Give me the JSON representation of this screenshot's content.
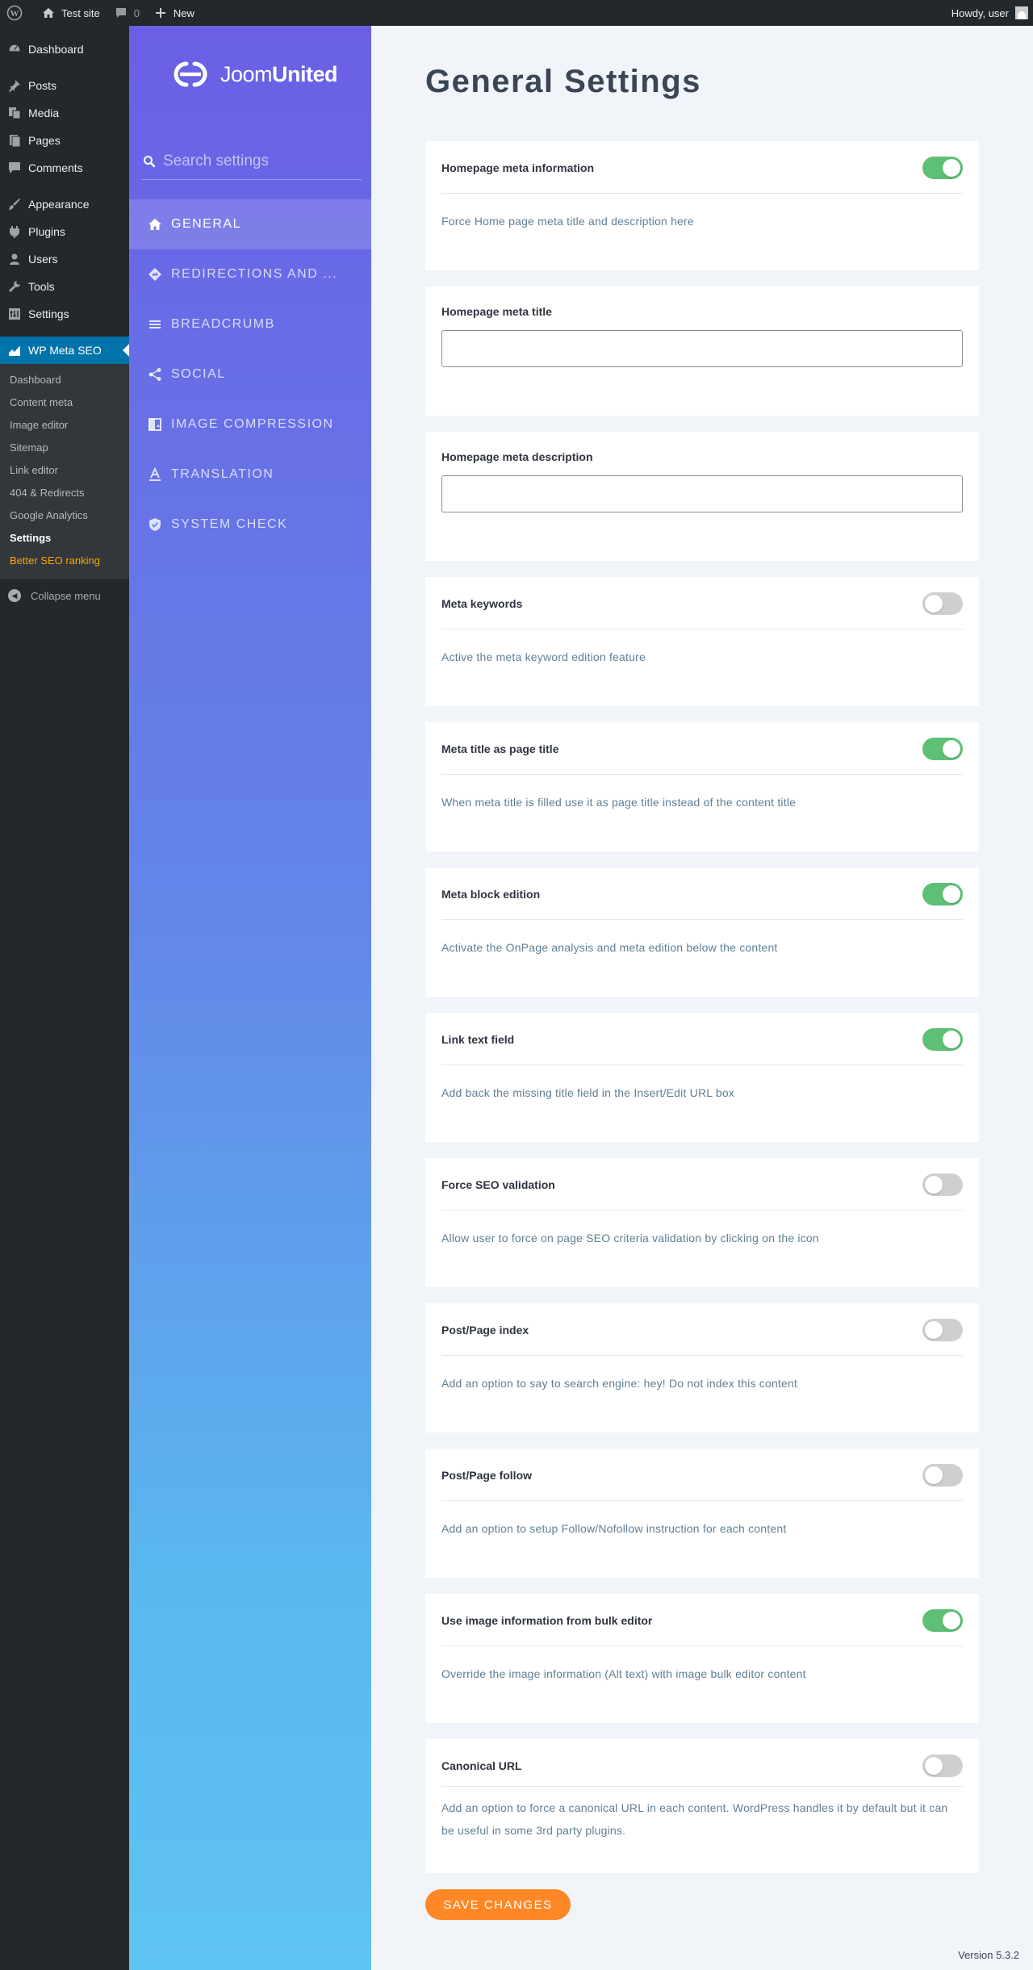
{
  "adminbar": {
    "site_name": "Test site",
    "comments_count": "0",
    "new_label": "New",
    "howdy": "Howdy, user"
  },
  "adminmenu": {
    "items": [
      {
        "label": "Dashboard",
        "icon": "dashboard-icon"
      },
      {
        "label": "Posts",
        "icon": "pin-icon"
      },
      {
        "label": "Media",
        "icon": "media-icon"
      },
      {
        "label": "Pages",
        "icon": "pages-icon"
      },
      {
        "label": "Comments",
        "icon": "comment-icon"
      },
      {
        "label": "Appearance",
        "icon": "brush-icon"
      },
      {
        "label": "Plugins",
        "icon": "plug-icon"
      },
      {
        "label": "Users",
        "icon": "user-icon"
      },
      {
        "label": "Tools",
        "icon": "wrench-icon"
      },
      {
        "label": "Settings",
        "icon": "settings-icon"
      },
      {
        "label": "WP Meta SEO",
        "icon": "chart-icon"
      }
    ],
    "submenu": [
      "Dashboard",
      "Content meta",
      "Image editor",
      "Sitemap",
      "Link editor",
      "404 & Redirects",
      "Google Analytics",
      "Settings",
      "Better SEO ranking"
    ],
    "collapse_label": "Collapse menu"
  },
  "plugin_sidebar": {
    "logo_text_light": "Joom",
    "logo_text_bold": "United",
    "search_placeholder": "Search settings",
    "nav": [
      {
        "label": "GENERAL",
        "icon": "home-icon"
      },
      {
        "label": "REDIRECTIONS AND ...",
        "icon": "directions-icon"
      },
      {
        "label": "BREADCRUMB",
        "icon": "breadcrumb-icon"
      },
      {
        "label": "SOCIAL",
        "icon": "share-icon"
      },
      {
        "label": "IMAGE COMPRESSION",
        "icon": "image-compression-icon"
      },
      {
        "label": "TRANSLATION",
        "icon": "translation-icon"
      },
      {
        "label": "SYSTEM CHECK",
        "icon": "shield-check-icon"
      }
    ]
  },
  "main": {
    "title": "General Settings",
    "settings": [
      {
        "label": "Homepage meta information",
        "type": "toggle",
        "on": true,
        "desc": "Force Home page meta title and description here"
      },
      {
        "label": "Homepage meta title",
        "type": "text",
        "value": ""
      },
      {
        "label": "Homepage meta description",
        "type": "text",
        "value": ""
      },
      {
        "label": "Meta keywords",
        "type": "toggle",
        "on": false,
        "desc": "Active the meta keyword edition feature"
      },
      {
        "label": "Meta title as page title",
        "type": "toggle",
        "on": true,
        "desc": "When meta title is filled use it as page title instead of the content title"
      },
      {
        "label": "Meta block edition",
        "type": "toggle",
        "on": true,
        "desc": "Activate the OnPage analysis and meta edition below the content"
      },
      {
        "label": "Link text field",
        "type": "toggle",
        "on": true,
        "desc": "Add back the missing title field in the Insert/Edit URL box"
      },
      {
        "label": "Force SEO validation",
        "type": "toggle",
        "on": false,
        "desc": "Allow user to force on page SEO criteria validation by clicking on the icon"
      },
      {
        "label": "Post/Page index",
        "type": "toggle",
        "on": false,
        "desc": "Add an option to say to search engine: hey! Do not index this content"
      },
      {
        "label": "Post/Page follow",
        "type": "toggle",
        "on": false,
        "desc": "Add an option to setup Follow/Nofollow instruction for each content"
      },
      {
        "label": "Use image information from bulk editor",
        "type": "toggle",
        "on": true,
        "desc": "Override the image information (Alt text) with image bulk editor content"
      },
      {
        "label": "Canonical URL",
        "type": "toggle",
        "on": false,
        "desc": "Add an option to force a canonical URL in each content. WordPress handles it by default but it can be useful in some 3rd party plugins."
      }
    ],
    "save_label": "SAVE CHANGES",
    "version": "Version 5.3.2"
  },
  "colors": {
    "toggle_on": "#5dc074",
    "toggle_off": "#cfcfcf",
    "save_button": "#ff8726",
    "wp_blue": "#0073aa"
  }
}
